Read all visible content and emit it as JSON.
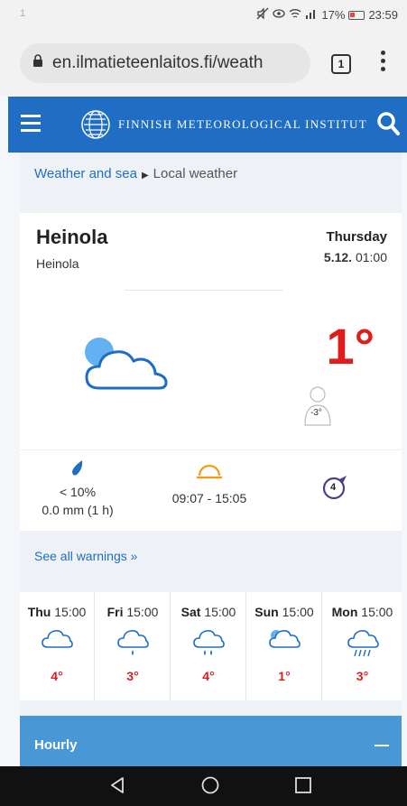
{
  "status": {
    "left": "1",
    "battery": "17%",
    "time": "23:59"
  },
  "browser": {
    "url": "en.ilmatieteenlaitos.fi/weath",
    "tab_count": "1"
  },
  "site": {
    "brand": "FINNISH METEOROLOGICAL INSTITUTE"
  },
  "breadcrumb": {
    "parent": "Weather and sea",
    "current": "Local weather"
  },
  "location": {
    "name": "Heinola",
    "sub": "Heinola",
    "day": "Thursday",
    "date": "5.12.",
    "time": "01:00"
  },
  "current": {
    "temperature": "1°",
    "feels_like": "-3°",
    "icon": "partly-cloudy-night-icon"
  },
  "stats": {
    "precip_chance": "< 10%",
    "precip_amount": "0.0 mm (1 h)",
    "sun_times": "09:07 - 15:05",
    "wind_speed": "4"
  },
  "warnings": {
    "link": "See all warnings »"
  },
  "forecast": [
    {
      "day": "Thu",
      "time": "15:00",
      "temp": "4°",
      "icon": "cloud-icon"
    },
    {
      "day": "Fri",
      "time": "15:00",
      "temp": "3°",
      "icon": "cloud-light-rain-icon"
    },
    {
      "day": "Sat",
      "time": "15:00",
      "temp": "4°",
      "icon": "cloud-rain-icon"
    },
    {
      "day": "Sun",
      "time": "15:00",
      "temp": "1°",
      "icon": "partly-cloudy-icon"
    },
    {
      "day": "Mon",
      "time": "15:00",
      "temp": "3°",
      "icon": "cloud-sleet-icon"
    }
  ],
  "hourly": {
    "label": "Hourly"
  },
  "colors": {
    "brand_blue": "#1f6ec4",
    "temp_red": "#e41b1b",
    "hourly_bar": "#4a97d6"
  }
}
